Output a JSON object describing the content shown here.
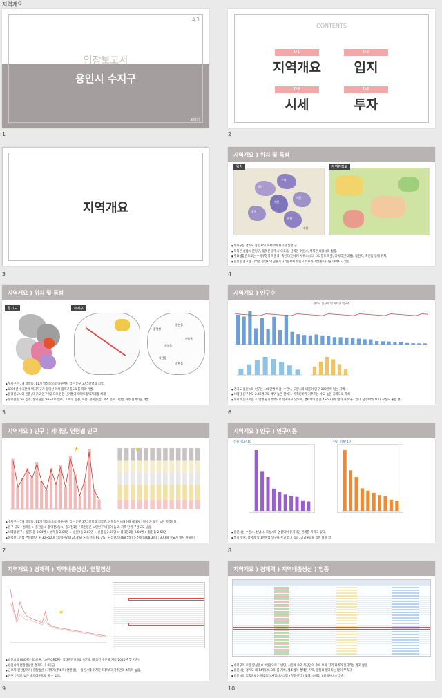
{
  "doc_label": "지역개요",
  "s1": {
    "num": "1",
    "page_no": "#3",
    "title1": "임장보고서",
    "title2": "용인시 수지구",
    "author": "도레미"
  },
  "s2": {
    "num": "2",
    "contents": "CONTENTS",
    "items": [
      {
        "n": "01",
        "t": "지역개요"
      },
      {
        "n": "02",
        "t": "입지"
      },
      {
        "n": "03",
        "t": "시세"
      },
      {
        "n": "04",
        "t": "투자"
      }
    ]
  },
  "s3": {
    "num": "3",
    "title": "지역개요"
  },
  "s4": {
    "num": "4",
    "head": "지역개요 ) 위치 및 특성",
    "tag1": "위치",
    "tag2": "지역편집도",
    "map_labels": [
      "용인",
      "수지",
      "기흥",
      "처인",
      "광주",
      "분당",
      "수원"
    ],
    "bullets": [
      "수지구는 경기도 용인시의 북서부에 위치한 일반 구",
      "북쪽은 성남시 분당구, 동쪽은 광주시 오포읍, 남쪽은 수원시, 서쪽은 의왕시와 접함.",
      "주요생활권으로는 수지구청역 학원가, 죽전역(신세계 사우스시티, 스타필드 마켓, 성복역(롯데몰), 동천역, 죽전동 등에 위치.",
      "신봉동 광교산 지역은 용인시의 공원녹지기본계획 수립으로 추가 개발될 여지를 이어지고 있음."
    ]
  },
  "s5": {
    "num": "5",
    "head": "지역개요 ) 위치 및 특성",
    "tag1": "경기도",
    "tag2": "수지구",
    "labels": [
      "풍덕천",
      "동천동",
      "신봉동",
      "성복동",
      "죽전동",
      "상현동"
    ],
    "bullets": [
      "수지구는 7개 행정동, 11개 법정동으로 이루어져 있는 인구 37.5만명의 지역.",
      "1995년 수지면에 택지지구가 들어선 이래 광역교통도로를 따라 개발.",
      "분당신도시와 인접, 대규모 인구유입으로 인한 난개발과 아파트형택지개발 체제",
      "풍덕천동 '95 입주, 풍덕천동 '98~'00 입주, 그 이후 동천, 죽전, 성복동(삼, 서초 은퇴 고령층 거주 실버타운 개발."
    ]
  },
  "s6": {
    "num": "6",
    "head": "지역개요 ) 인구수",
    "chart_title": "경기도 인구수 및 세대당 인구수",
    "chart_data": {
      "type": "bar",
      "title": "경기도 인구수 및 세대당 인구수",
      "categories": [
        "1",
        "2",
        "3",
        "4",
        "5",
        "6",
        "7",
        "8",
        "9",
        "10",
        "11",
        "12",
        "13",
        "14",
        "15",
        "16",
        "17",
        "18",
        "19",
        "20",
        "21",
        "22",
        "23",
        "24",
        "25",
        "26",
        "27",
        "28",
        "29",
        "30",
        "31",
        "32"
      ],
      "series": [
        {
          "values": [
            1073000,
            1013000,
            1200000,
            588000,
            958000,
            563000,
            1007000,
            523000,
            1077000,
            459000,
            371000,
            344000,
            330000,
            364000,
            330000,
            312000,
            268000,
            265000,
            254000,
            224000,
            212000,
            192000,
            187000,
            124000,
            117000,
            111000,
            98000,
            98000,
            55000,
            48000,
            43000,
            41000
          ]
        }
      ]
    },
    "bullets": [
      "경기도 용인시의 인구는 108만명 이상. 수원시, 고양시와 더불어 인구 100만이 넘는 지역.",
      "세대당 인구수도 2.46명으로 매우 높은 편이다. 가족단위가 거주하는 수요 높은 지역으로 해석",
      "수지의 인구수는 37만명을 지속적으로 유지하고 있으며, 경제력이 높은 4~50대가 많이 거주하고 있다. 영유아와 10대 구성도 좋은 편."
    ]
  },
  "s7": {
    "num": "7",
    "head": "지역개요 ) 인구 ) 세대당, 연령별 인구",
    "chart_data": [
      {
        "type": "bar",
        "categories": [
          "1",
          "2",
          "3",
          "4",
          "5",
          "6",
          "7",
          "8",
          "9",
          "10",
          "11",
          "12",
          "13",
          "14",
          "15",
          "16",
          "17",
          "18",
          "19"
        ],
        "series": [
          {
            "values": [
              8.0,
              3.5,
              5.0,
              6.5,
              5.0,
              7.5,
              4.5,
              3.0,
              6.5,
              4.0,
              7.0,
              3.5,
              8.5,
              5.5,
              2.0,
              4.5,
              9.5,
              3.0,
              1.5
            ]
          }
        ]
      },
      {
        "type": "bar",
        "categories": [
          "1",
          "2",
          "3",
          "4",
          "5",
          "6",
          "7",
          "8",
          "9",
          "10",
          "11",
          "12",
          "13"
        ],
        "series": [
          {
            "values": [
              100,
              100,
              100,
              100,
              100,
              100,
              100,
              100,
              100,
              100,
              100,
              100,
              100
            ]
          }
        ]
      }
    ],
    "bullets": [
      "수지구는 7개 행정동, 11개 법정동으로 이루어져 있는 인구 37.5만명의 지역구, 성복동은 세대수와 세대당 인구수가 모두 높은 지역이다.",
      "인구 규모 : 성복동 > 풍천동 > 풍덕천2동 > 풍덕천1동 / 죽전동은 노인인구 비율이 높고, 가족 단위 구성도도 낮음.",
      "세대당 인구 : 상현1동 3.04명 > 성복동 2.89명 > 상현2동 2.87명 > 신봉동 2.81명 > 풍덕천2동 2.68명 > 동천동 2.59명",
      "풍덕천1 인접 연령(유아 + 30~50대 : 풍덕천2동(74.4%) > 동천동(68.7%) > 상현2동(68.5%) > 신봉동(68.3%) : 30대와 수요가 많지 않을까?"
    ]
  },
  "s8": {
    "num": "8",
    "head": "지역개요 ) 인구 ) 인구이동",
    "tag1": "전출 TOP 10",
    "tag2": "전입 TOP 10",
    "chart_data": [
      {
        "type": "bar",
        "title": "용인 수지구 전출 인구TOP 10",
        "categories": [
          "1",
          "2",
          "3",
          "4",
          "5",
          "6",
          "7",
          "8",
          "9",
          "10"
        ],
        "values": [
          2600,
          1700,
          1450,
          950,
          800,
          700,
          650,
          600,
          450,
          400
        ]
      },
      {
        "type": "bar",
        "title": "용인 수지구 전입 인구TOP 10",
        "categories": [
          "1",
          "2",
          "3",
          "4",
          "5",
          "6",
          "7",
          "8",
          "9",
          "10"
        ],
        "values": [
          2700,
          1800,
          1500,
          1000,
          900,
          800,
          700,
          650,
          500,
          450
        ]
      }
    ],
    "bullets": [
      "용인시는 수원시, 성남시, 화성시와 연결되어 유기적인 관계를 가지고 있다.",
      "특히 수원, 성남이 약 1만명의 인구를 주고 받고 있음. 공급물량을 함께 봐야 함."
    ]
  },
  "s9": {
    "num": "9",
    "head": "지역개요 ) 경제력 ) 지역내총생산, 연말정산",
    "chart_data": {
      "type": "line",
      "x": [
        "1",
        "2",
        "3",
        "4",
        "5",
        "6",
        "7",
        "8",
        "9",
        "10",
        "11",
        "12",
        "13",
        "14",
        "15",
        "16",
        "17",
        "18",
        "19",
        "20",
        "21",
        "22",
        "23",
        "24",
        "25",
        "26",
        "27",
        "28",
        "29",
        "30",
        "31"
      ],
      "series": [
        {
          "values": [
            95,
            60,
            40,
            72,
            58,
            48,
            45,
            42,
            40,
            38,
            35,
            55,
            33,
            30,
            28,
            27,
            26,
            25,
            24,
            23,
            22,
            21,
            20,
            19,
            18,
            17,
            16,
            15,
            14,
            13,
            12
          ]
        },
        {
          "values": [
            70,
            55,
            35,
            50,
            45,
            40,
            42,
            38,
            36,
            34,
            32,
            40,
            30,
            28,
            26,
            25,
            24,
            23,
            22,
            21,
            20,
            19,
            18,
            17,
            16,
            15,
            14,
            13,
            12,
            11,
            10
          ]
        }
      ]
    },
    "bullets": [
      "용인시의 GRDP는 35조원, 10년 GRDP는 약 3천만원으로 경기도 내 중간 수준을 기록(2020년 및 기준)",
      "용인시의 연말정산은 경기도 내 8등급",
      "근로자(원천징수자) 연말정산 ( 거주자(주소지) 연말정산 ) 용인시에 위치한 직장보다 거주민의 소득이 높음.",
      "거주 선택도 높은 베드타운으로 볼 수 있음."
    ]
  },
  "s10": {
    "num": "10",
    "head": "지역개요 ) 경제력 ) 지역내총생산 ) 업종",
    "bullets": [
      "수지구의 직장 활성은 0.2만명으로 다방면, 시업체 수와 직장인의 수로 보아 지역 자체의 일자리는 많지 않음.",
      "용인시는 경기도 내 14위(25.3조)를 기록, 제조업이 경제인 지역, 양질의 일자리는 많이 부족다.",
      "용인시의 업종으로는 제조업 ) 사업서비스업 ) 부동산업 ) 도매, 소매업 ) 교육서비스업 순."
    ]
  }
}
